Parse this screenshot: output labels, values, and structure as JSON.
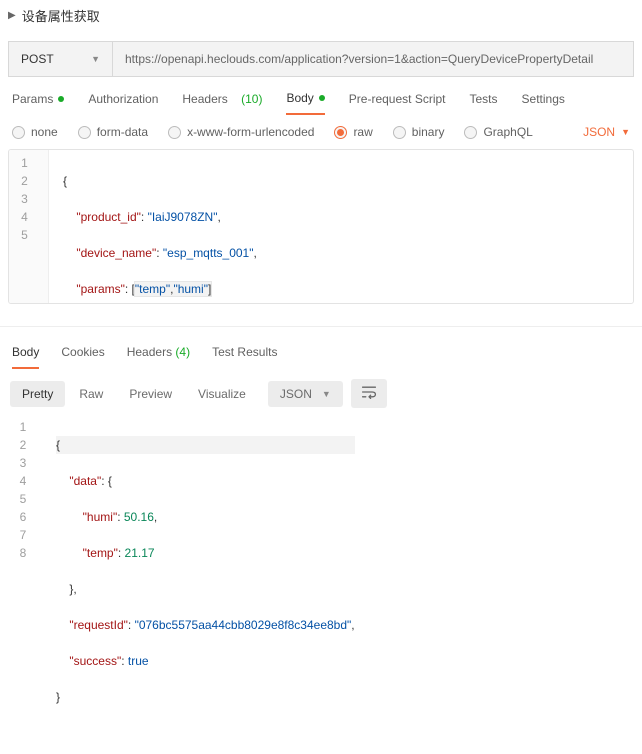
{
  "header": {
    "title": "设备属性获取"
  },
  "request": {
    "method": "POST",
    "url": "https://openapi.heclouds.com/application?version=1&action=QueryDevicePropertyDetail"
  },
  "tabs": {
    "params": "Params",
    "authorization": "Authorization",
    "headers": "Headers",
    "headers_count": "(10)",
    "body": "Body",
    "prerequest": "Pre-request Script",
    "tests": "Tests",
    "settings": "Settings"
  },
  "body_types": {
    "none": "none",
    "formdata": "form-data",
    "xwww": "x-www-form-urlencoded",
    "raw": "raw",
    "binary": "binary",
    "graphql": "GraphQL",
    "format": "JSON"
  },
  "req_code": {
    "l1": "{",
    "l2a": "    \"product_id\"",
    "l2b": ": ",
    "l2c": "\"IaiJ9078ZN\"",
    "l2d": ",",
    "l3a": "    \"device_name\"",
    "l3b": ": ",
    "l3c": "\"esp_mqtts_001\"",
    "l3d": ",",
    "l4a": "    \"params\"",
    "l4b": ": [",
    "l4c": "\"temp\"",
    "l4d": ",",
    "l4e": "\"humi\"",
    "l4f": "]",
    "l5": "}",
    "ln": {
      "1": "1",
      "2": "2",
      "3": "3",
      "4": "4",
      "5": "5"
    }
  },
  "resp_tabs": {
    "body": "Body",
    "cookies": "Cookies",
    "headers": "Headers",
    "headers_count": "(4)",
    "testresults": "Test Results"
  },
  "resp_toolbar": {
    "pretty": "Pretty",
    "raw": "Raw",
    "preview": "Preview",
    "visualize": "Visualize",
    "format": "JSON"
  },
  "resp_code": {
    "l1": "{",
    "l2a": "    \"data\"",
    "l2b": ": {",
    "l3a": "        \"humi\"",
    "l3b": ": ",
    "l3c": "50.16",
    "l3d": ",",
    "l4a": "        \"temp\"",
    "l4b": ": ",
    "l4c": "21.17",
    "l5": "    },",
    "l6a": "    \"requestId\"",
    "l6b": ": ",
    "l6c": "\"076bc5575aa44cbb8029e8f8c34ee8bd\"",
    "l6d": ",",
    "l7a": "    \"success\"",
    "l7b": ": ",
    "l7c": "true",
    "l8": "}",
    "ln": {
      "1": "1",
      "2": "2",
      "3": "3",
      "4": "4",
      "5": "5",
      "6": "6",
      "7": "7",
      "8": "8"
    }
  }
}
